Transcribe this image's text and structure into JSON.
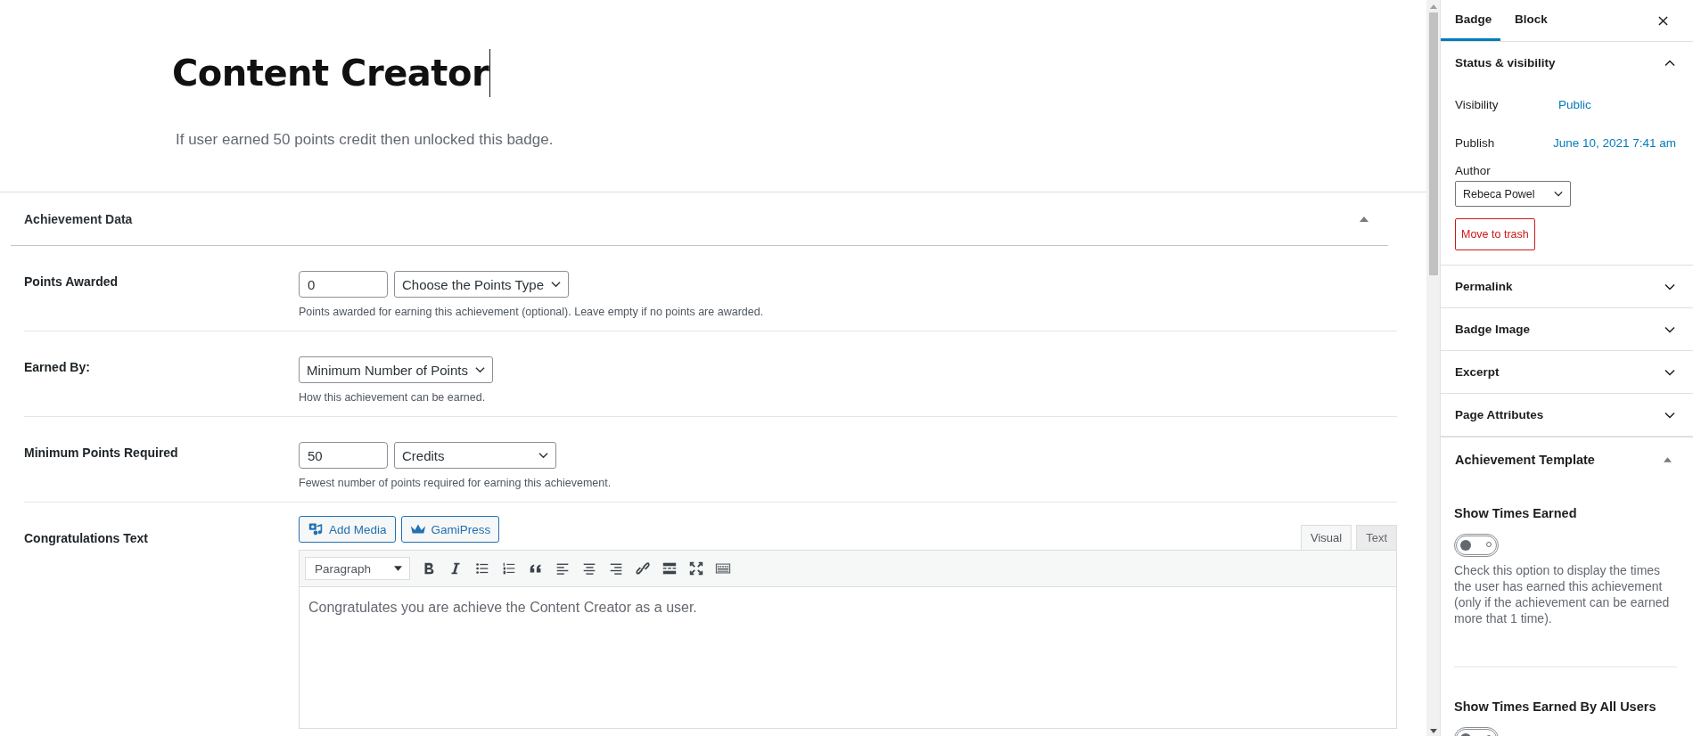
{
  "title": "Content Creator",
  "subtitle": "If user earned 50 points credit then unlocked this badge.",
  "metabox": {
    "title": "Achievement Data",
    "expanded": true
  },
  "fields": [
    {
      "kind": "number_select",
      "label": "Points Awarded",
      "value": "0",
      "select": "Choose the Points Type",
      "help": "Points awarded for earning this achievement (optional). Leave empty if no points are awarded."
    },
    {
      "kind": "select",
      "label": "Earned By:",
      "select": "Minimum Number of Points",
      "help": "How this achievement can be earned."
    },
    {
      "kind": "number_select",
      "label": "Minimum Points Required",
      "value": "50",
      "select": "Credits",
      "help": "Fewest number of points required for earning this achievement."
    },
    {
      "kind": "editor",
      "label": "Congratulations Text",
      "buttons": [
        "Add Media",
        "GamiPress"
      ],
      "tabs": [
        {
          "label": "Visual",
          "selected": true
        },
        {
          "label": "Text",
          "selected": false
        }
      ],
      "format": "Paragraph",
      "content": "Congratulates you are achieve the Content Creator as a user."
    }
  ],
  "sidebar": {
    "tabs": [
      {
        "label": "Badge",
        "selected": true
      },
      {
        "label": "Block",
        "selected": false
      }
    ],
    "status": {
      "title": "Status & visibility",
      "expanded": true,
      "rows": [
        {
          "label": "Visibility",
          "value": "Public"
        },
        {
          "label": "Publish",
          "value": "June 10, 2021 7:41 am"
        }
      ],
      "author_label": "Author",
      "author": "Rebeca Powel",
      "trash": "Move to trash"
    },
    "panels": [
      {
        "title": "Permalink",
        "expanded": false
      },
      {
        "title": "Badge Image",
        "expanded": false
      },
      {
        "title": "Excerpt",
        "expanded": false
      },
      {
        "title": "Page Attributes",
        "expanded": false
      }
    ],
    "template": {
      "title": "Achievement Template",
      "expanded": true,
      "options": [
        {
          "title": "Show Times Earned",
          "on": false,
          "help": "Check this option to display the times the user has earned this achievement (only if the achievement can be earned more that 1 time)."
        },
        {
          "title": "Show Times Earned By All Users",
          "on": false
        }
      ]
    }
  }
}
